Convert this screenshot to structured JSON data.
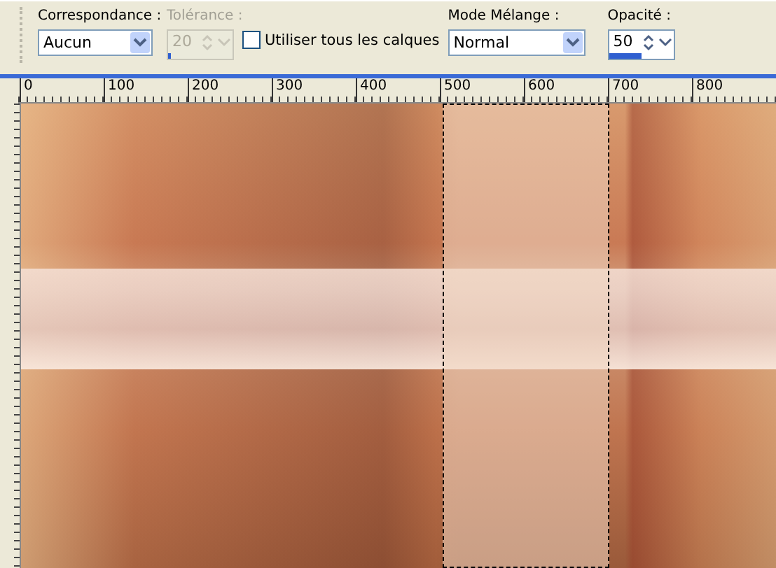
{
  "toolbar": {
    "match": {
      "label": "Correspondance :",
      "value": "Aucun"
    },
    "tolerance": {
      "label": "Tolérance :",
      "value": "20",
      "disabled": true,
      "level": 0.05
    },
    "all_layers": {
      "label": "Utiliser tous les calques",
      "checked": false
    },
    "blend_mode": {
      "label": "Mode Mélange :",
      "value": "Normal"
    },
    "opacity": {
      "label": "Opacité :",
      "value": "50",
      "level": 0.5
    }
  },
  "ruler": {
    "labels": [
      "0",
      "100",
      "200",
      "300",
      "400",
      "500",
      "600",
      "700",
      "800"
    ]
  }
}
